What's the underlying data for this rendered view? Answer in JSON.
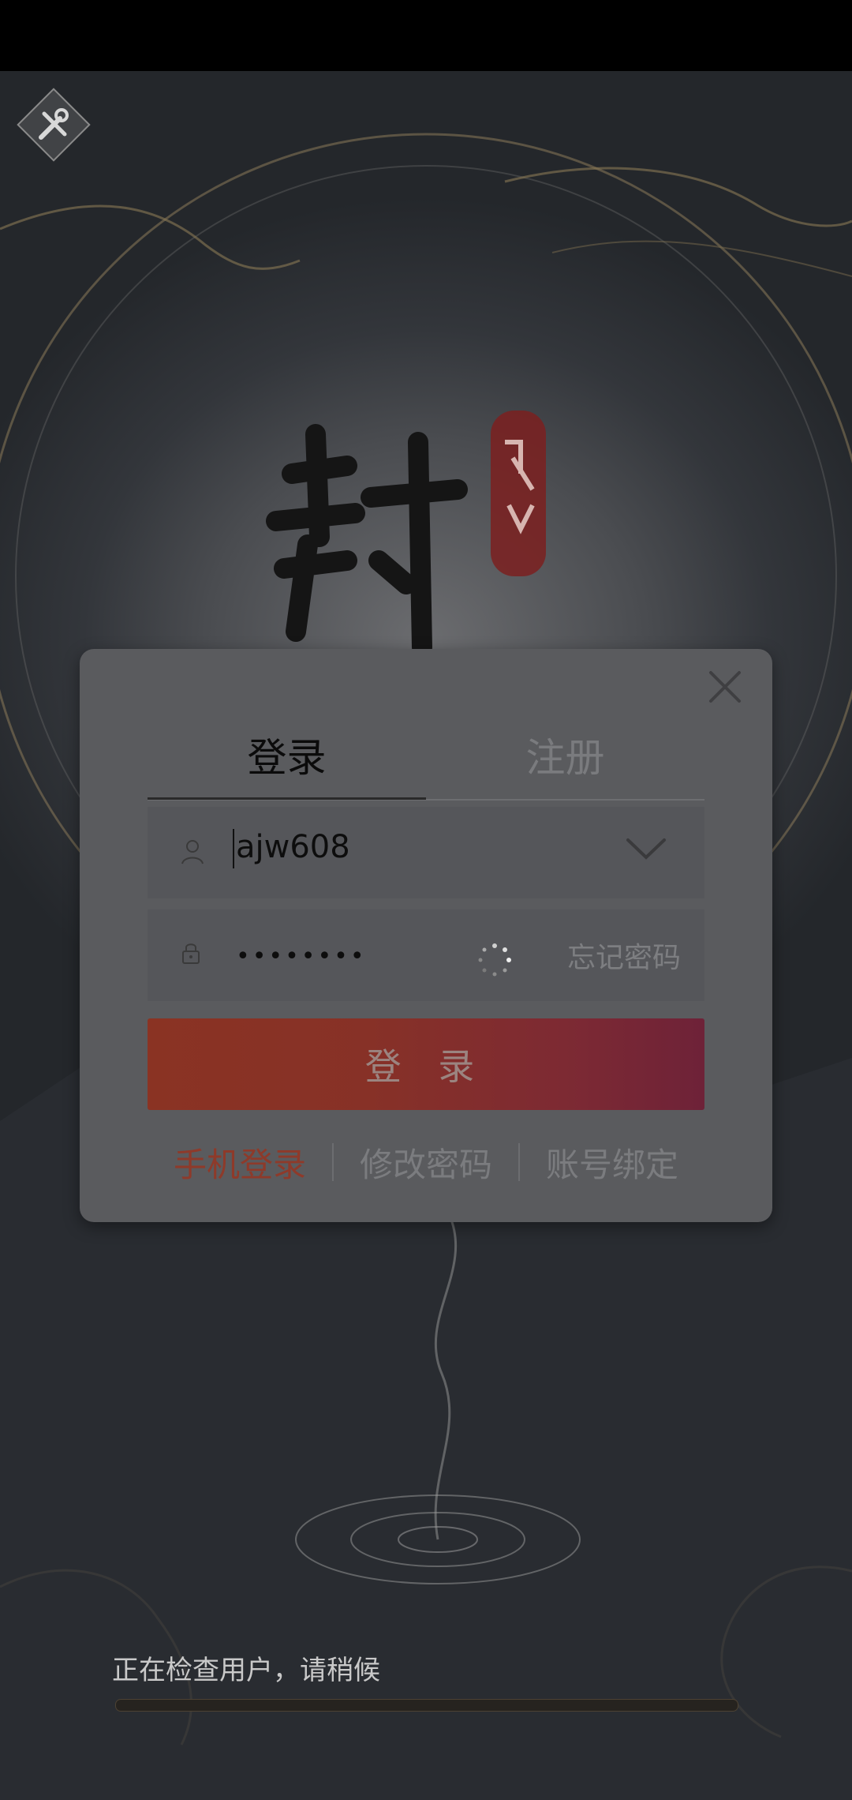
{
  "dialog": {
    "tabs": {
      "login": "登录",
      "register": "注册"
    },
    "username_value": "ajw608",
    "password_mask": "••••••••",
    "forgot_label": "忘记密码",
    "login_button": "登 录",
    "links": {
      "phone_login": "手机登录",
      "change_password": "修改密码",
      "bind_account": "账号绑定"
    }
  },
  "loading": {
    "status": "正在检查用户，请稍候",
    "progress": 0
  },
  "colors": {
    "accent": "#8e3a2a",
    "button_start": "#8a3323",
    "button_end": "#6e2238"
  },
  "icons": [
    "tools-icon",
    "close-icon",
    "user-icon",
    "chevron-down-icon",
    "lock-icon",
    "spinner-icon"
  ]
}
